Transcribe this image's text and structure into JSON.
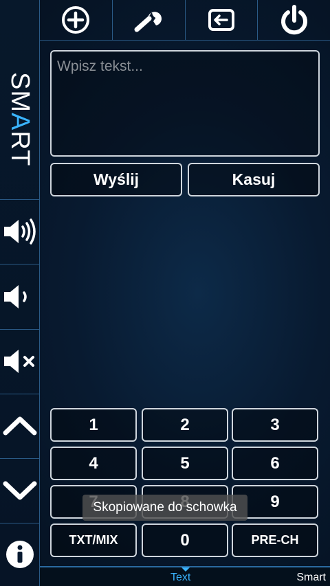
{
  "sidebar": {
    "logo_text_before": "SM",
    "logo_text_accent": "A",
    "logo_text_after": "RT"
  },
  "input": {
    "placeholder": "Wpisz tekst...",
    "value": ""
  },
  "actions": {
    "send_label": "Wyślij",
    "clear_label": "Kasuj"
  },
  "keypad": {
    "k1": "1",
    "k2": "2",
    "k3": "3",
    "k4": "4",
    "k5": "5",
    "k6": "6",
    "k7": "7",
    "k8": "8",
    "k9": "9",
    "txt_mix": "TXT/MIX",
    "k0": "0",
    "pre_ch": "PRE-CH"
  },
  "toast": {
    "message": "Skopiowane do schowka"
  },
  "tabs": {
    "text_label": "Text",
    "smart_label": "Smart"
  },
  "colors": {
    "accent": "#3ab4ff",
    "border": "#cfd6dd",
    "background": "#081a30"
  }
}
